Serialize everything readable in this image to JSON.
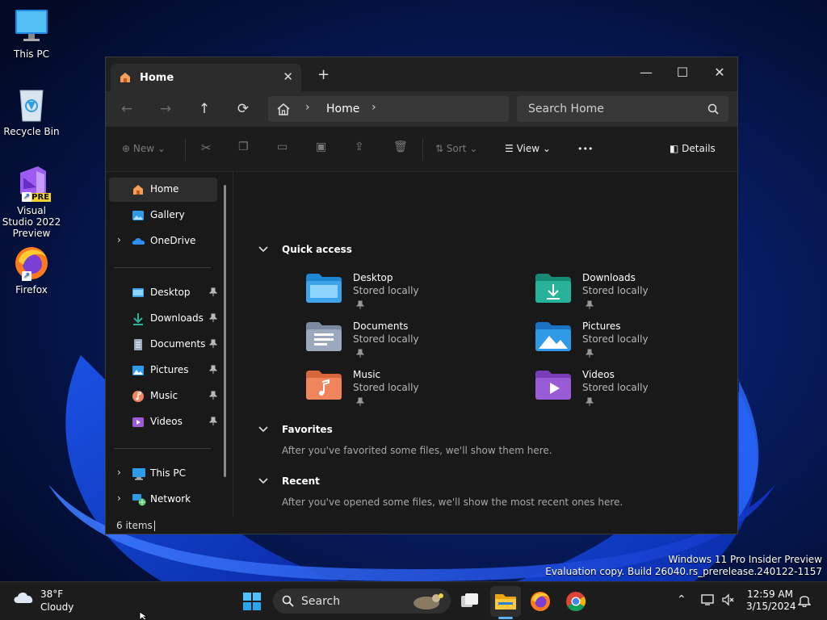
{
  "desktop": {
    "icons": [
      {
        "label": "This PC",
        "icon": "monitor-icon"
      },
      {
        "label": "Recycle Bin",
        "icon": "recycle-bin-icon"
      },
      {
        "label": "Visual Studio 2022 Preview",
        "icon": "visual-studio-icon",
        "badge": "PRE"
      },
      {
        "label": "Firefox",
        "icon": "firefox-icon"
      }
    ],
    "watermark": {
      "line1": "Windows 11 Pro Insider Preview",
      "line2": "Evaluation copy. Build 26040.rs_prerelease.240122-1157"
    }
  },
  "explorer": {
    "tab": {
      "label": "Home",
      "close": "✕"
    },
    "new_tab": "+",
    "window_controls": {
      "minimize": "—",
      "maximize": "☐",
      "close": "✕"
    },
    "address": {
      "crumb": "Home",
      "sep": "›"
    },
    "search": {
      "placeholder": "Search Home"
    },
    "commands": {
      "new": "New",
      "sort": "Sort",
      "view": "View",
      "more": "•••",
      "details": "Details"
    },
    "sidebar": {
      "top": [
        {
          "label": "Home",
          "icon": "home-icon",
          "selected": true
        },
        {
          "label": "Gallery",
          "icon": "gallery-icon"
        },
        {
          "label": "OneDrive",
          "icon": "onedrive-icon",
          "expandable": true
        }
      ],
      "pinned": [
        {
          "label": "Desktop",
          "icon": "desktop-folder-icon"
        },
        {
          "label": "Downloads",
          "icon": "downloads-icon"
        },
        {
          "label": "Documents",
          "icon": "documents-icon"
        },
        {
          "label": "Pictures",
          "icon": "pictures-icon"
        },
        {
          "label": "Music",
          "icon": "music-icon"
        },
        {
          "label": "Videos",
          "icon": "videos-icon"
        }
      ],
      "bottom": [
        {
          "label": "This PC",
          "icon": "this-pc-icon"
        },
        {
          "label": "Network",
          "icon": "network-icon"
        }
      ]
    },
    "quick_access": {
      "title": "Quick access",
      "items": [
        {
          "name": "Desktop",
          "sub": "Stored locally",
          "color": "#3ea3e8"
        },
        {
          "name": "Downloads",
          "sub": "Stored locally",
          "color": "#27b39a"
        },
        {
          "name": "Documents",
          "sub": "Stored locally",
          "color": "#9aa9bd"
        },
        {
          "name": "Pictures",
          "sub": "Stored locally",
          "color": "#2f9ae8"
        },
        {
          "name": "Music",
          "sub": "Stored locally",
          "color": "#f0845c"
        },
        {
          "name": "Videos",
          "sub": "Stored locally",
          "color": "#9a5cd6"
        }
      ]
    },
    "favorites": {
      "title": "Favorites",
      "message": "After you've favorited some files, we'll show them here."
    },
    "recent": {
      "title": "Recent",
      "message": "After you've opened some files, we'll show the most recent ones here."
    },
    "status": {
      "count": "6 items"
    }
  },
  "taskbar": {
    "weather": {
      "temp": "38°F",
      "condition": "Cloudy"
    },
    "search_label": "Search",
    "clock": {
      "time": "12:59 AM",
      "date": "3/15/2024"
    },
    "accent": "#5ab0f5"
  }
}
